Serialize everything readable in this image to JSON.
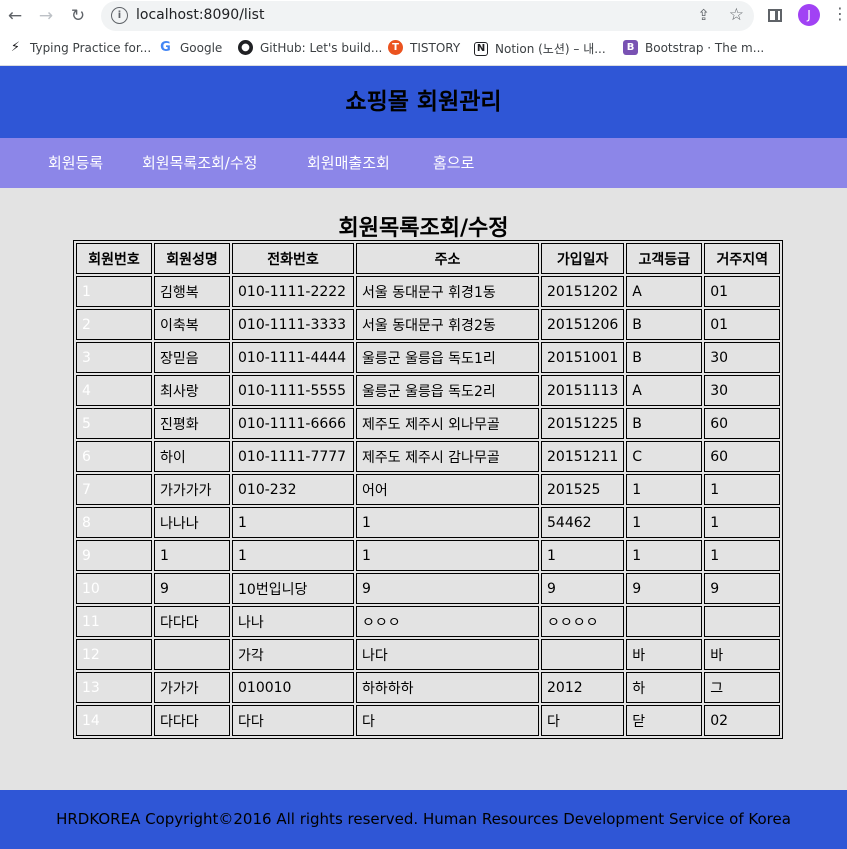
{
  "browser": {
    "url": "localhost:8090/list",
    "avatar_letter": "J",
    "bookmarks": [
      {
        "icon": "lightning-icon",
        "label": "Typing Practice for...",
        "color": "#202124"
      },
      {
        "icon": "google-icon",
        "label": "Google",
        "color": "#4285f4"
      },
      {
        "icon": "github-icon",
        "label": "GitHub: Let's build...",
        "color": "#202124"
      },
      {
        "icon": "tistory-icon",
        "label": "TISTORY",
        "color": "#eb531f"
      },
      {
        "icon": "notion-icon",
        "label": "Notion (노션) – 내...",
        "color": "#202124"
      },
      {
        "icon": "bootstrap-icon",
        "label": "Bootstrap · The m...",
        "color": "#7952b3"
      }
    ]
  },
  "page": {
    "header_title": "쇼핑몰 회원관리",
    "nav": [
      "회원등록",
      "회원목록조회/수정",
      "회원매출조회",
      "홈으로"
    ],
    "section_title": "회원목록조회/수정",
    "table": {
      "headers": [
        "회원번호",
        "회원성명",
        "전화번호",
        "주소",
        "가입일자",
        "고객등급",
        "거주지역"
      ],
      "rows": [
        [
          "1",
          "김행복",
          "010-1111-2222",
          "서울 동대문구 휘경1동",
          "20151202",
          "A",
          "01"
        ],
        [
          "2",
          "이축복",
          "010-1111-3333",
          "서울 동대문구 휘경2동",
          "20151206",
          "B",
          "01"
        ],
        [
          "3",
          "장믿음",
          "010-1111-4444",
          "울릉군 울릉읍 독도1리",
          "20151001",
          "B",
          "30"
        ],
        [
          "4",
          "최사랑",
          "010-1111-5555",
          "울릉군 울릉읍 독도2리",
          "20151113",
          "A",
          "30"
        ],
        [
          "5",
          "진평화",
          "010-1111-6666",
          "제주도 제주시 외나무골",
          "20151225",
          "B",
          "60"
        ],
        [
          "6",
          "하이",
          "010-1111-7777",
          "제주도 제주시 감나무골",
          "20151211",
          "C",
          "60"
        ],
        [
          "7",
          "가가가가",
          "010-232",
          "어어",
          "201525",
          "1",
          "1"
        ],
        [
          "8",
          "나나나",
          "1",
          "1",
          "54462",
          "1",
          "1"
        ],
        [
          "9",
          "1",
          "1",
          "1",
          "1",
          "1",
          "1"
        ],
        [
          "10",
          "9",
          "10번입니당",
          "9",
          "9",
          "9",
          "9"
        ],
        [
          "11",
          "다다다",
          "나나",
          "ㅇㅇㅇ",
          "ㅇㅇㅇㅇ",
          "",
          ""
        ],
        [
          "12",
          "",
          "가각",
          "나다",
          "",
          "바",
          "바"
        ],
        [
          "13",
          "가가가",
          "010010",
          "하하하하",
          "2012",
          "하",
          "그"
        ],
        [
          "14",
          "다다다",
          "다다",
          "다",
          "다",
          "닫",
          "02"
        ]
      ]
    },
    "footer": "HRDKOREA Copyright©2016 All rights reserved. Human Resources Development Service of Korea"
  },
  "colors": {
    "header_bg": "#2f56d6",
    "nav_bg": "#8c86e8",
    "section_bg": "#e3e3e3",
    "footer_bg": "#2f56d6"
  }
}
